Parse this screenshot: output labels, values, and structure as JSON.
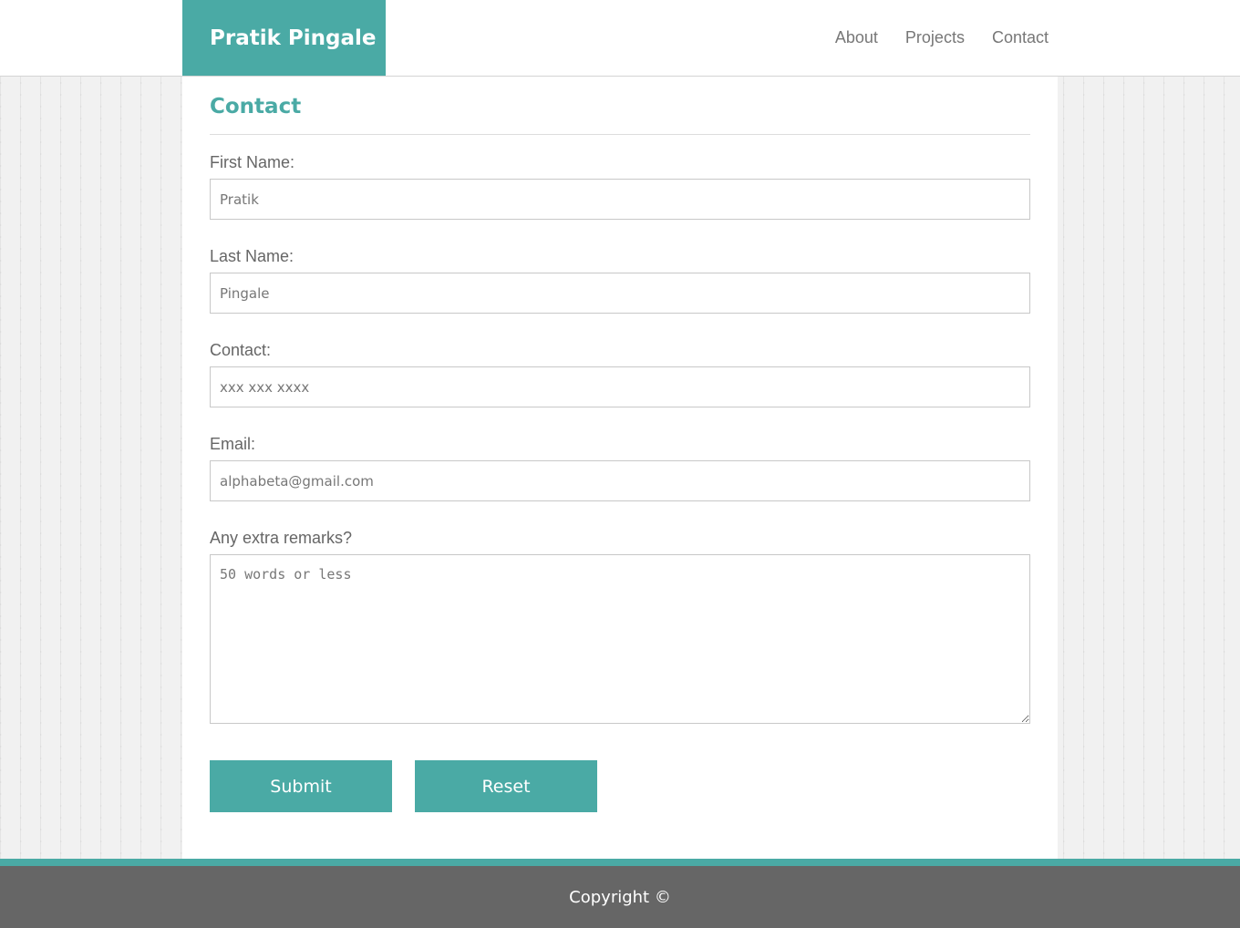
{
  "header": {
    "brand": "Pratik Pingale",
    "nav": [
      {
        "label": "About"
      },
      {
        "label": "Projects"
      },
      {
        "label": "Contact"
      }
    ]
  },
  "main": {
    "title": "Contact",
    "fields": {
      "first_name": {
        "label": "First Name:",
        "placeholder": "Pratik",
        "value": ""
      },
      "last_name": {
        "label": "Last Name:",
        "placeholder": "Pingale",
        "value": ""
      },
      "contact": {
        "label": "Contact:",
        "placeholder": "xxx xxx xxxx",
        "value": ""
      },
      "email": {
        "label": "Email:",
        "placeholder": "alphabeta@gmail.com",
        "value": ""
      },
      "remarks": {
        "label": "Any extra remarks?",
        "placeholder": "50 words or less",
        "value": ""
      }
    },
    "buttons": {
      "submit": "Submit",
      "reset": "Reset"
    }
  },
  "footer": {
    "text": "Copyright ©"
  },
  "colors": {
    "accent": "#4aaaa5",
    "footer_bg": "#666666",
    "text": "#666666"
  }
}
